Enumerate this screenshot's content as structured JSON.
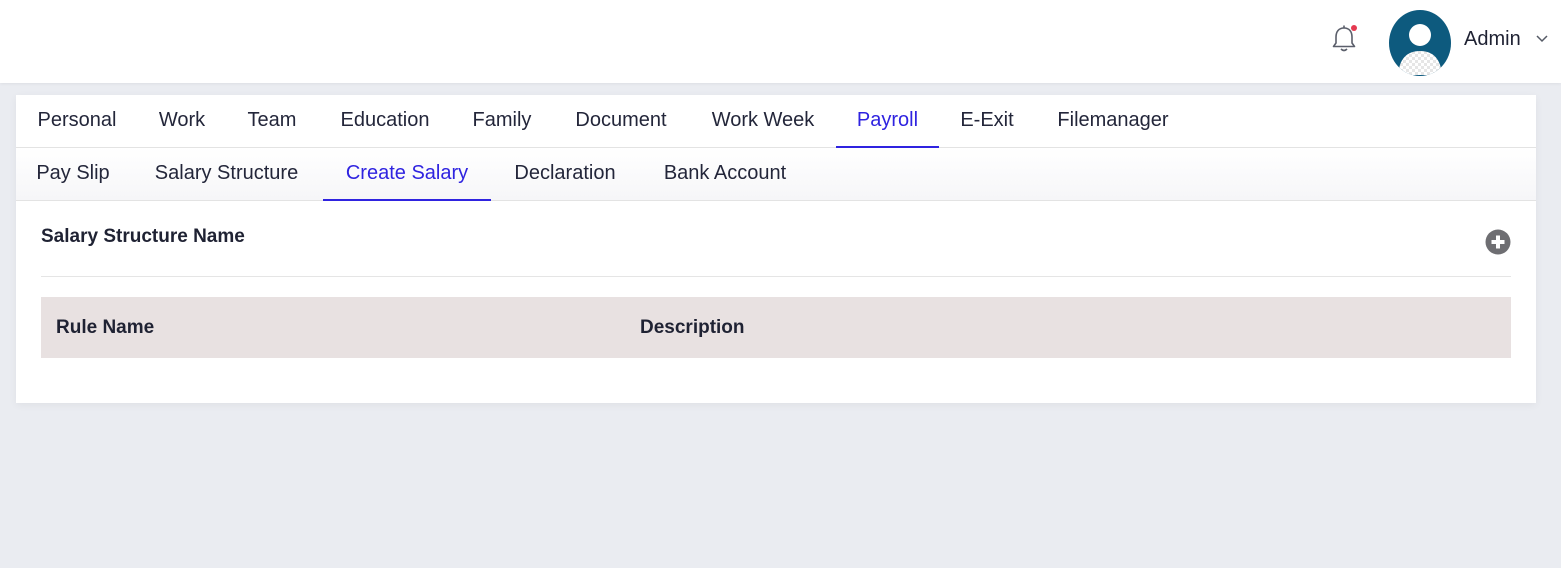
{
  "header": {
    "user_name": "Admin",
    "notification_dot_color": "#e53950",
    "icons": [
      "bell-icon",
      "user-avatar-icon",
      "chevron-down-icon"
    ]
  },
  "primary_tabs": [
    {
      "label": "Personal",
      "active": false
    },
    {
      "label": "Work",
      "active": false
    },
    {
      "label": "Team",
      "active": false
    },
    {
      "label": "Education",
      "active": false
    },
    {
      "label": "Family",
      "active": false
    },
    {
      "label": "Document",
      "active": false
    },
    {
      "label": "Work Week",
      "active": false
    },
    {
      "label": "Payroll",
      "active": true
    },
    {
      "label": "E-Exit",
      "active": false
    },
    {
      "label": "Filemanager",
      "active": false
    }
  ],
  "secondary_tabs": [
    {
      "label": "Pay Slip",
      "active": false
    },
    {
      "label": "Salary Structure",
      "active": false
    },
    {
      "label": "Create Salary",
      "active": true
    },
    {
      "label": "Declaration",
      "active": false
    },
    {
      "label": "Bank Account",
      "active": false
    }
  ],
  "content": {
    "section_title": "Salary Structure Name",
    "add_icon": "plus-circle-icon",
    "table": {
      "columns": [
        "Rule Name",
        "Description"
      ],
      "rows": []
    }
  },
  "colors": {
    "accent": "#2f23e0",
    "table_header_bg": "#e8e1e1",
    "avatar_bg": "#0d5a7e",
    "page_bg": "#eaecf1"
  }
}
